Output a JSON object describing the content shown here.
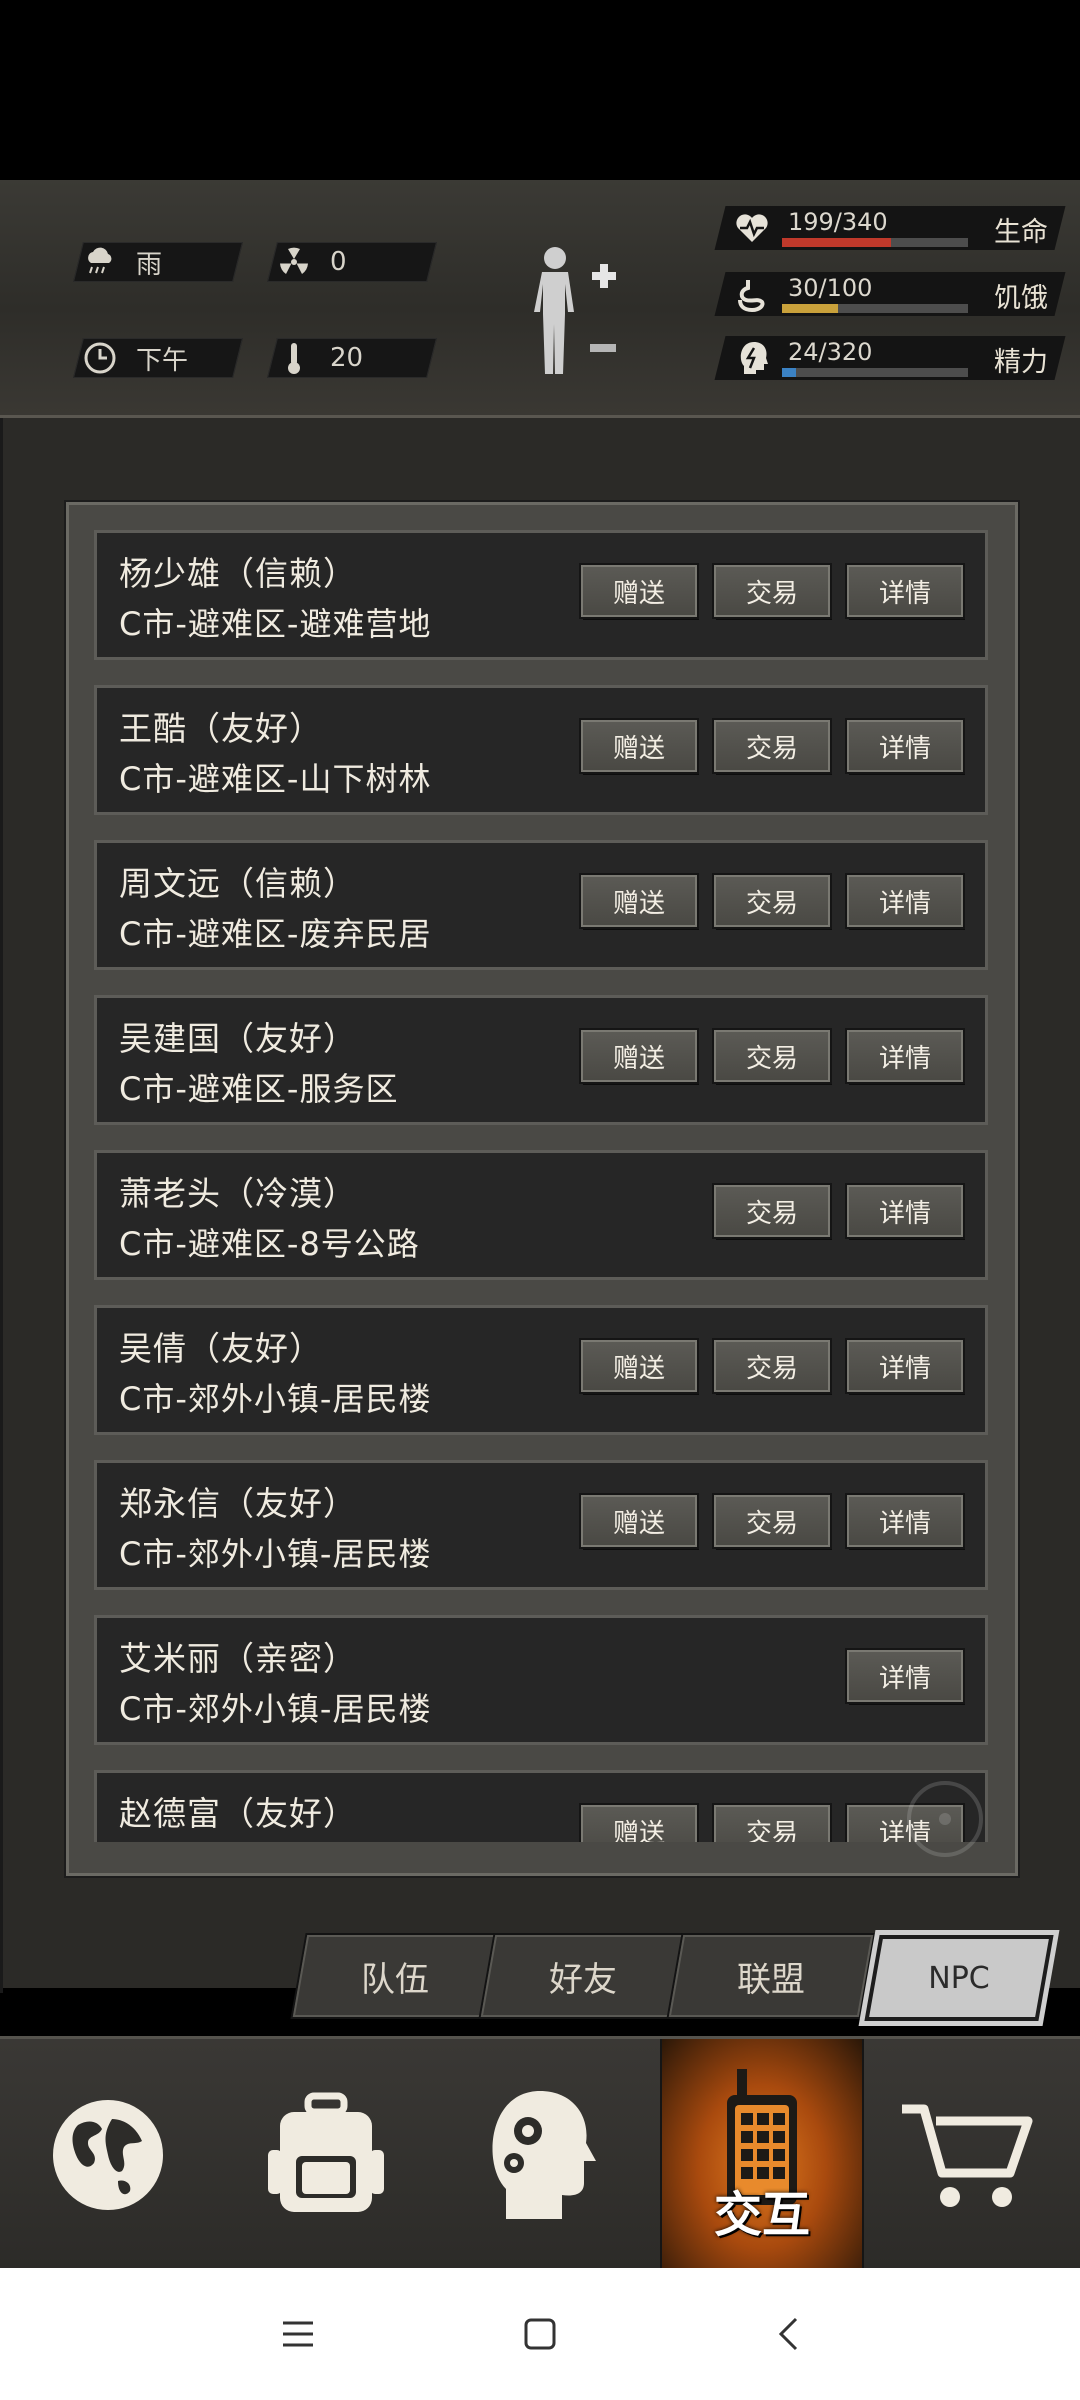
{
  "status": {
    "weather": "雨",
    "radiation": "0",
    "time_of_day": "下午",
    "temperature": "20"
  },
  "vitals": [
    {
      "label": "生命",
      "value": "199/340",
      "current": 199,
      "max": 340,
      "color": "#c0392b",
      "icon": "heart-pulse-icon"
    },
    {
      "label": "饥饿",
      "value": "30/100",
      "current": 30,
      "max": 100,
      "color": "#c9a13b",
      "icon": "stomach-icon"
    },
    {
      "label": "精力",
      "value": "24/320",
      "current": 24,
      "max": 320,
      "color": "#3b82c4",
      "icon": "head-energy-icon"
    }
  ],
  "npcs": [
    {
      "name": "杨少雄（信赖）",
      "location": "C市-避难区-避难营地",
      "buttons": [
        "赠送",
        "交易",
        "详情"
      ]
    },
    {
      "name": "王酷（友好）",
      "location": "C市-避难区-山下树林",
      "buttons": [
        "赠送",
        "交易",
        "详情"
      ]
    },
    {
      "name": "周文远（信赖）",
      "location": "C市-避难区-废弃民居",
      "buttons": [
        "赠送",
        "交易",
        "详情"
      ]
    },
    {
      "name": "吴建国（友好）",
      "location": "C市-避难区-服务区",
      "buttons": [
        "赠送",
        "交易",
        "详情"
      ]
    },
    {
      "name": "萧老头（冷漠）",
      "location": "C市-避难区-8号公路",
      "buttons": [
        "交易",
        "详情"
      ]
    },
    {
      "name": "吴倩（友好）",
      "location": "C市-郊外小镇-居民楼",
      "buttons": [
        "赠送",
        "交易",
        "详情"
      ]
    },
    {
      "name": "郑永信（友好）",
      "location": "C市-郊外小镇-居民楼",
      "buttons": [
        "赠送",
        "交易",
        "详情"
      ]
    },
    {
      "name": "艾米丽（亲密）",
      "location": "C市-郊外小镇-居民楼",
      "buttons": [
        "详情"
      ]
    },
    {
      "name": "赵德富（友好）",
      "location": "",
      "buttons": [
        "赠送",
        "交易",
        "详情"
      ]
    }
  ],
  "tabs": [
    {
      "label": "队伍",
      "active": false
    },
    {
      "label": "好友",
      "active": false
    },
    {
      "label": "联盟",
      "active": false
    },
    {
      "label": "NPC",
      "active": true
    }
  ],
  "bottom_nav": {
    "items": [
      "globe-icon",
      "backpack-icon",
      "skills-head-icon",
      "walkie-talkie-icon",
      "shopping-cart-icon"
    ],
    "active_label": "交互"
  },
  "colors": {
    "active_nav": "#e07a1f",
    "panel": "#4a4945",
    "card": "#262626"
  }
}
